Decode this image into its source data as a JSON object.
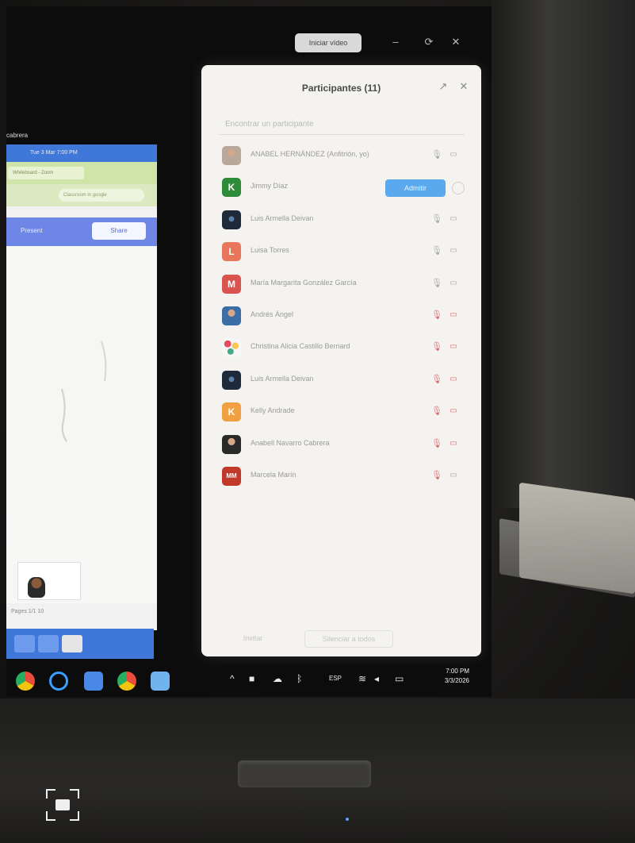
{
  "app": {
    "name": "Zoom",
    "window_label": "cabrera"
  },
  "zoom_mini": {
    "stop_video_label": "Iniciar vídeo",
    "minimize_icon": "minimize-icon",
    "expand_icon": "expand-icon",
    "close_icon": "close-icon"
  },
  "participants": {
    "title": "Participantes (11)",
    "search_placeholder": "Encontrar un participante",
    "admit_label": "Admitir",
    "items": [
      {
        "name": "ANABEL HERNÁNDEZ (Anfitrión, yo)",
        "initial": "",
        "color": "#b8a89a",
        "mic": "unmuted",
        "cam": "unmuted",
        "avatar_type": "photo"
      },
      {
        "name": "Jimmy Díaz",
        "initial": "K",
        "color": "#2e8b3a",
        "mic": "",
        "cam": "",
        "avatar_type": "letter",
        "waiting": true
      },
      {
        "name": "Luis Armella Deivan",
        "initial": "",
        "color": "#1e2a3a",
        "mic": "unmuted",
        "cam": "unmuted",
        "avatar_type": "dark"
      },
      {
        "name": "Luisa Torres",
        "initial": "L",
        "color": "#e8765a",
        "mic": "unmuted",
        "cam": "unmuted",
        "avatar_type": "letter"
      },
      {
        "name": "María Margarita González García",
        "initial": "M",
        "color": "#d9534f",
        "mic": "unmuted",
        "cam": "unmuted",
        "avatar_type": "letter"
      },
      {
        "name": "Andrés Ángel",
        "initial": "",
        "color": "#3a6ea5",
        "mic": "muted",
        "cam": "muted",
        "avatar_type": "photo"
      },
      {
        "name": "Christina Alicia Castillo Bernard",
        "initial": "",
        "color": "#f2f2f2",
        "mic": "muted",
        "cam": "muted",
        "avatar_type": "flowers"
      },
      {
        "name": "Luis Armella Deivan",
        "initial": "",
        "color": "#1e2a3a",
        "mic": "muted",
        "cam": "muted",
        "avatar_type": "dark"
      },
      {
        "name": "Kelly Andrade",
        "initial": "K",
        "color": "#f0a040",
        "mic": "muted",
        "cam": "muted",
        "avatar_type": "letter"
      },
      {
        "name": "Anabell Navarro Cabrera",
        "initial": "",
        "color": "#2a2a2a",
        "mic": "muted",
        "cam": "muted",
        "avatar_type": "photo"
      },
      {
        "name": "Marcela Marín",
        "initial": "MM",
        "color": "#c0392b",
        "mic": "muted",
        "cam": "unmuted",
        "avatar_type": "letter"
      }
    ],
    "footer_invite": "Invitar",
    "footer_mute_all": "Silenciar a todos"
  },
  "taskbar": {
    "language": "ESP",
    "time": "7:00 PM",
    "date": "3/3/2026"
  },
  "left_window": {
    "title": "Tue 3 Mar  7:00 PM",
    "tab_label": "Whiteboard - Zoom",
    "address": "Classroom in google",
    "present_label": "Present",
    "share_label": "Share",
    "status_text": "Pages  1/1  10"
  },
  "colors": {
    "panel_bg": "#f4f3ef",
    "admit_blue": "#5aa9ef",
    "muted_red": "#e06a75",
    "taskbar_blue": "#3f78d8"
  }
}
